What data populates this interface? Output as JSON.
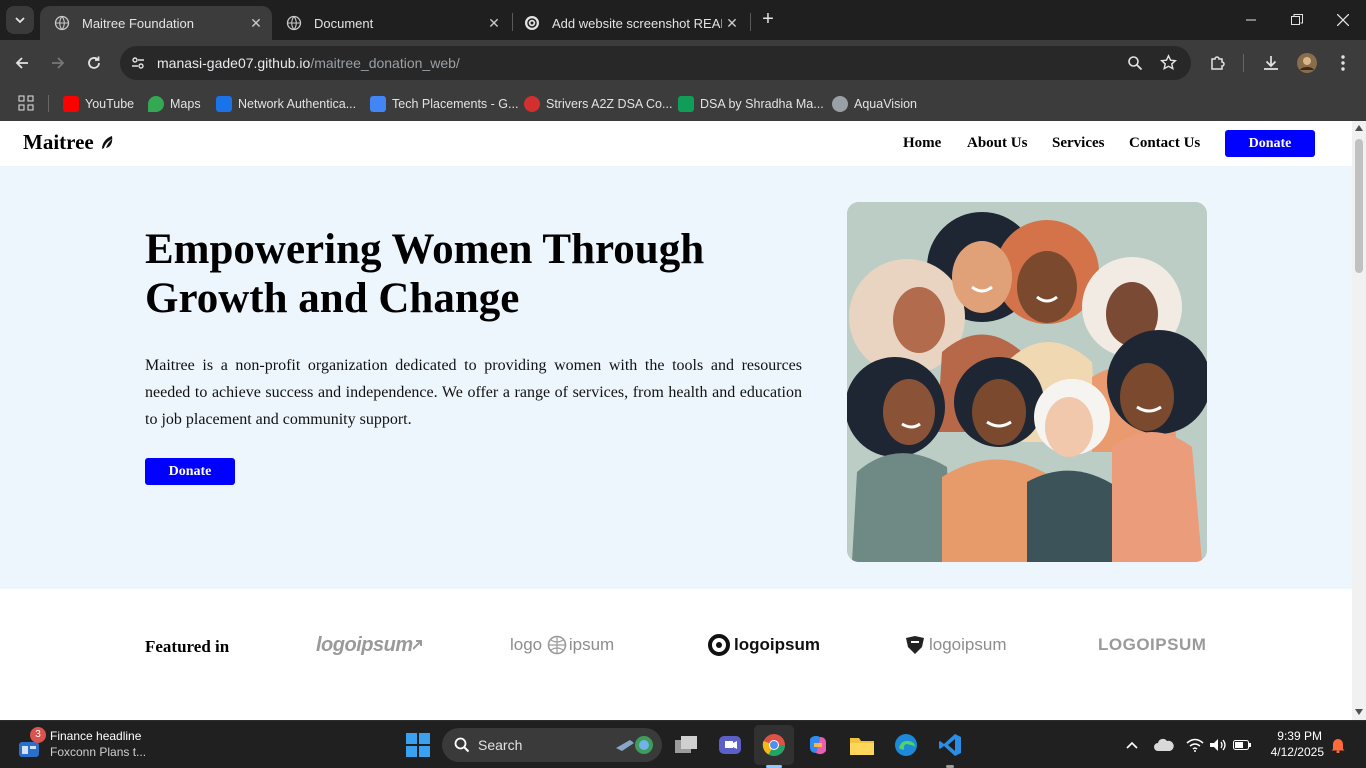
{
  "browser": {
    "tabs": [
      {
        "title": "Maitree Foundation",
        "active": true
      },
      {
        "title": "Document",
        "active": false
      },
      {
        "title": "Add website screenshot READM",
        "active": false
      }
    ],
    "url_host": "manasi-gade07.github.io",
    "url_path": "/maitree_donation_web/",
    "bookmarks": [
      {
        "label": "YouTube",
        "color": "#ff0000"
      },
      {
        "label": "Maps",
        "color": "#34a853"
      },
      {
        "label": "Network Authentica...",
        "color": "#1a73e8"
      },
      {
        "label": "Tech Placements - G...",
        "color": "#4285f4"
      },
      {
        "label": "Strivers A2Z DSA Co...",
        "color": "#d32f2f"
      },
      {
        "label": "DSA by Shradha Ma...",
        "color": "#0f9d58"
      },
      {
        "label": "AquaVision",
        "color": "#9aa0a6"
      }
    ]
  },
  "site": {
    "logo": "Maitree",
    "nav": {
      "home": "Home",
      "about": "About Us",
      "services": "Services",
      "contact": "Contact Us",
      "donate": "Donate"
    },
    "hero": {
      "heading": "Empowering Women Through Growth and Change",
      "paragraph": "Maitree is a non-profit organization dedicated to providing women with the tools and resources needed to achieve success and independence. We offer a range of services, from health and education to job placement and community support.",
      "donate": "Donate"
    },
    "featured": {
      "label": "Featured in",
      "logos": [
        "logoipsum",
        "logo ipsum",
        "logoipsum",
        "logoipsum",
        "LOGOIPSUM"
      ]
    },
    "accent_color": "#0000ff"
  },
  "taskbar": {
    "news_title": "Finance headline",
    "news_sub": "Foxconn Plans t...",
    "news_badge": "3",
    "search": "Search",
    "time": "9:39 PM",
    "date": "4/12/2025"
  }
}
